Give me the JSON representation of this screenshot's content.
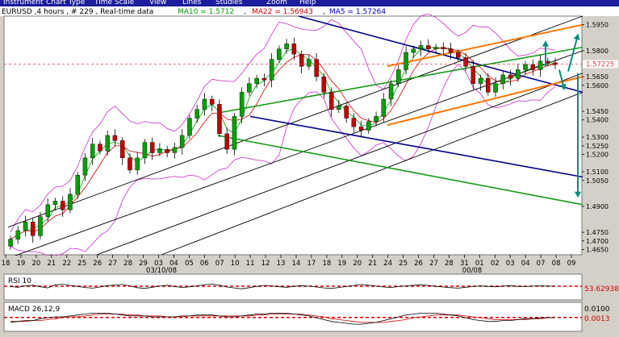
{
  "menu": {
    "items": [
      "Instrument",
      "Chart Type",
      "Time Scale",
      "View",
      "Lines",
      "Studies",
      "Zoom",
      "Help"
    ]
  },
  "header": {
    "symbol": "EURUSD",
    "interval": "4 hours",
    "bars": "# 229",
    "mode": "Real-time data",
    "ma10_text": "MA10 = 1.5712",
    "ma22_text": "MA22 = 1.56943",
    "ma5_text": "MA5 = 1.57264",
    "ma10_color": "#00a000",
    "ma22_color": "#d00000",
    "ma5_color": "#0000c0"
  },
  "colors": {
    "candle_up": "#00a000",
    "candle_down": "#c00000",
    "wick": "#000000",
    "bollinger": "#cc44cc",
    "channel_black": "#000000",
    "channel_blue": "#00008b",
    "channel_green": "#169b16",
    "channel_orange": "#ff7700",
    "arrow": "#0e8a7c",
    "price_marker": "#e04040"
  },
  "chart_data": {
    "type": "candlestick",
    "symbol": "EURUSD",
    "price_axis": {
      "min": 1.462,
      "max": 1.6,
      "ticks": [
        1.595,
        1.58,
        1.565,
        1.56,
        1.545,
        1.54,
        1.53,
        1.525,
        1.52,
        1.51,
        1.505,
        1.49,
        1.475,
        1.47,
        1.465
      ]
    },
    "current_price": "1.57225",
    "date_axis": {
      "ticks": [
        "18",
        "19",
        "20",
        "21",
        "22",
        "25",
        "26",
        "27",
        "28",
        "29",
        "03",
        "04",
        "05",
        "06",
        "07",
        "10",
        "11",
        "12",
        "13",
        "14",
        "17",
        "18",
        "19",
        "20",
        "21",
        "24",
        "25",
        "26",
        "27",
        "28",
        "31",
        "01",
        "02",
        "03",
        "04",
        "07",
        "08",
        "09"
      ],
      "month_labels": [
        "03/10/08",
        "00/08"
      ]
    },
    "close": [
      1.471,
      1.476,
      1.481,
      1.473,
      1.484,
      1.491,
      1.493,
      1.488,
      1.497,
      1.508,
      1.518,
      1.526,
      1.522,
      1.531,
      1.528,
      1.518,
      1.511,
      1.518,
      1.527,
      1.521,
      1.523,
      1.521,
      1.524,
      1.531,
      1.541,
      1.546,
      1.552,
      1.549,
      1.532,
      1.523,
      1.542,
      1.556,
      1.561,
      1.564,
      1.563,
      1.575,
      1.581,
      1.584,
      1.578,
      1.571,
      1.575,
      1.565,
      1.556,
      1.546,
      1.548,
      1.541,
      1.536,
      1.534,
      1.539,
      1.542,
      1.552,
      1.561,
      1.569,
      1.579,
      1.581,
      1.583,
      1.581,
      1.582,
      1.581,
      1.579,
      1.576,
      1.571,
      1.561,
      1.564,
      1.556,
      1.561,
      1.566,
      1.564,
      1.569,
      1.572,
      1.569,
      1.574,
      1.573,
      1.572
    ],
    "indicators": [
      {
        "name": "RSI 10",
        "value_label": "53.62938",
        "value": 53.62938,
        "range": [
          0,
          100
        ],
        "line_color": "#000000",
        "level_color": "#e00000",
        "series": [
          52,
          49,
          55,
          58,
          51,
          46,
          60,
          62,
          57,
          53,
          48,
          45,
          50,
          56,
          59,
          61,
          55,
          47,
          44,
          49,
          54,
          58,
          52,
          48,
          51,
          55,
          60,
          63,
          58,
          50,
          46,
          42,
          47,
          53,
          57,
          55,
          51,
          49,
          53,
          56,
          54,
          50,
          46,
          44,
          48,
          52,
          57,
          61,
          58,
          54,
          50,
          48,
          52,
          55,
          58,
          60,
          57,
          53,
          50,
          47,
          45,
          49,
          52,
          55,
          53,
          51,
          54,
          56,
          53,
          52,
          54,
          55,
          54,
          53.6
        ]
      },
      {
        "name": "MACD 26,12,9",
        "value_label": "0.0013",
        "value": 0.0013,
        "axis_label": "0.0100",
        "axis_value": 0.01,
        "range": [
          -0.012,
          0.016
        ],
        "line_color": "#000000",
        "signal_color": "#d00000",
        "level_color": "#e00000",
        "macd": [
          -0.004,
          -0.003,
          -0.002,
          -0.002,
          0.0,
          0.001,
          0.002,
          0.002,
          0.003,
          0.004,
          0.005,
          0.006,
          0.006,
          0.006,
          0.005,
          0.004,
          0.003,
          0.003,
          0.003,
          0.002,
          0.002,
          0.002,
          0.002,
          0.003,
          0.003,
          0.004,
          0.004,
          0.004,
          0.003,
          0.002,
          0.002,
          0.003,
          0.004,
          0.005,
          0.005,
          0.006,
          0.006,
          0.006,
          0.005,
          0.004,
          0.003,
          0.001,
          -0.001,
          -0.003,
          -0.004,
          -0.005,
          -0.006,
          -0.006,
          -0.005,
          -0.004,
          -0.002,
          0.0,
          0.002,
          0.004,
          0.005,
          0.006,
          0.006,
          0.006,
          0.005,
          0.004,
          0.003,
          0.001,
          -0.001,
          -0.002,
          -0.003,
          -0.003,
          -0.002,
          -0.002,
          -0.001,
          0.0,
          0.0,
          0.001,
          0.001,
          0.0013
        ],
        "signal": [
          -0.003,
          -0.003,
          -0.003,
          -0.002,
          -0.002,
          -0.001,
          0.0,
          0.001,
          0.002,
          0.002,
          0.003,
          0.004,
          0.005,
          0.005,
          0.005,
          0.005,
          0.004,
          0.004,
          0.003,
          0.003,
          0.003,
          0.002,
          0.002,
          0.002,
          0.003,
          0.003,
          0.003,
          0.003,
          0.003,
          0.003,
          0.003,
          0.003,
          0.003,
          0.004,
          0.004,
          0.005,
          0.005,
          0.005,
          0.005,
          0.005,
          0.004,
          0.003,
          0.002,
          0.0,
          -0.001,
          -0.002,
          -0.003,
          -0.004,
          -0.004,
          -0.004,
          -0.004,
          -0.003,
          -0.002,
          -0.001,
          0.001,
          0.002,
          0.003,
          0.004,
          0.004,
          0.004,
          0.004,
          0.003,
          0.002,
          0.001,
          0.0,
          -0.001,
          -0.001,
          -0.001,
          -0.001,
          -0.001,
          0.0,
          0.0,
          0.001,
          0.001
        ]
      }
    ]
  }
}
